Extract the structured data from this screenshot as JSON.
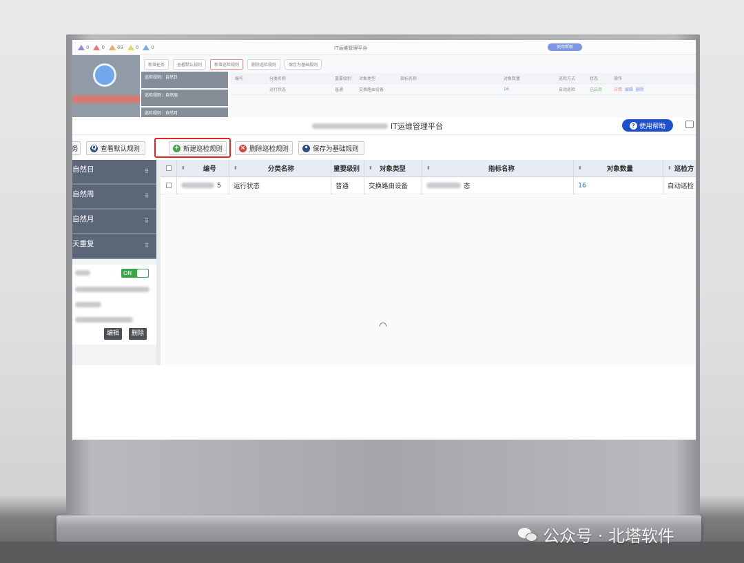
{
  "background_app": {
    "alerts": [
      "0",
      "0",
      "69",
      "0",
      "0"
    ],
    "title": "IT运维管理平台",
    "help_label": "使用帮助",
    "toolbar": [
      "新增任务",
      "查看默认规则",
      "新增巡检规则",
      "删除巡检规则",
      "保存为基础规则"
    ],
    "side_items": [
      "巡检规则：自然日",
      "巡检规则：自然周",
      "巡检规则：自然月"
    ],
    "header": [
      "编号",
      "分类名称",
      "重要级别",
      "对象类型",
      "指标名称",
      "对象数量",
      "巡检方式",
      "状态",
      "操作"
    ],
    "row": [
      "运行状态",
      "普通",
      "交换路由设备",
      "16",
      "自动巡检",
      "已启用",
      "详情",
      "编辑",
      "删除"
    ]
  },
  "header": {
    "title": "IT运维管理平台",
    "help_label": "使用帮助",
    "colors": {
      "help_bg": "#1e4fcf"
    }
  },
  "toolbar": {
    "view_default_rules": "查看默认规则",
    "add_inspection_rule": "新建巡检规则",
    "delete_inspection_rule": "删除巡检规则",
    "save_as_base_rule": "保存为基础规则",
    "truncated_left": "务"
  },
  "sidebar": {
    "items": [
      {
        "label": "自然日"
      },
      {
        "label": "自然周"
      },
      {
        "label": "自然月"
      },
      {
        "label": "天重复"
      }
    ],
    "toggle_label": "ON",
    "edit_label": "编辑",
    "delete_label": "删除"
  },
  "table": {
    "columns": [
      "编号",
      "分类名称",
      "重要级别",
      "对象类型",
      "指标名称",
      "对象数量",
      "巡检方"
    ],
    "rows": [
      {
        "id_suffix": "5",
        "category": "运行状态",
        "level": "普通",
        "object_type": "交换路由设备",
        "metric_suffix": "态",
        "count": "16",
        "mode": "自动巡检"
      }
    ]
  },
  "watermark": {
    "text": "公众号 · 北塔软件"
  }
}
